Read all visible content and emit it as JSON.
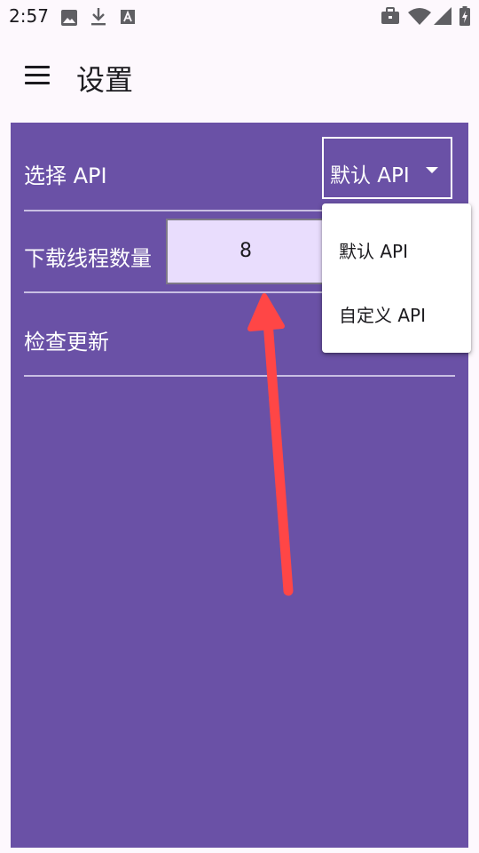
{
  "status_bar": {
    "time": "2:57",
    "left_icons": [
      "image-icon",
      "download-icon",
      "font-a-icon"
    ],
    "right_icons": [
      "briefcase-icon",
      "wifi-icon",
      "signal-icon",
      "battery-icon"
    ]
  },
  "app_bar": {
    "title": "设置",
    "menu_icon": "hamburger-menu-icon"
  },
  "settings": {
    "select_api": {
      "label": "选择 API",
      "value": "默认 API"
    },
    "download_threads": {
      "label": "下载线程数量",
      "value": "8"
    },
    "check_update": {
      "label": "检查更新"
    }
  },
  "dropdown": {
    "options": [
      "默认 API",
      "自定义 API"
    ]
  },
  "colors": {
    "panel": "#6a51a6",
    "input_bg": "#e9ddfd",
    "arrow": "#ff4646",
    "background": "#fdf8fd"
  }
}
